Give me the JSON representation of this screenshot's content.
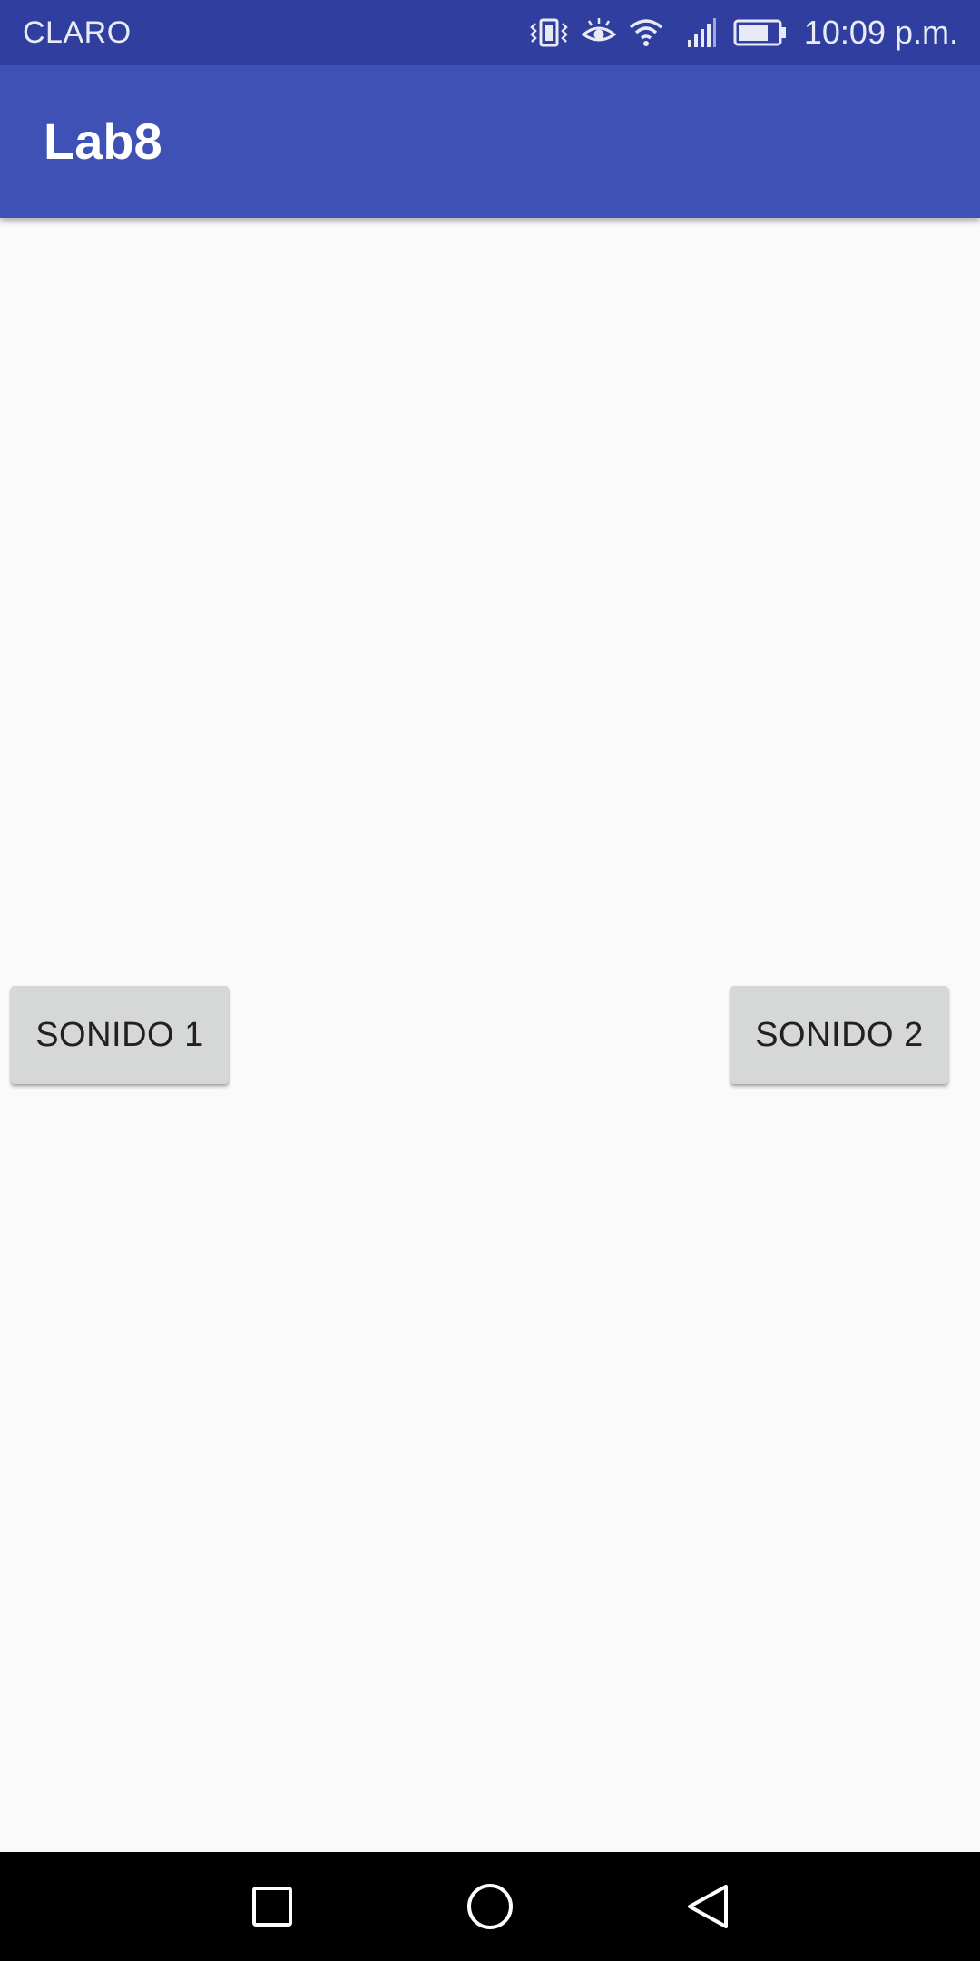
{
  "status_bar": {
    "carrier": "CLARO",
    "time": "10:09 p.m.",
    "icons": [
      "vibrate-icon",
      "eye-comfort-icon",
      "wifi-icon",
      "signal-icon",
      "battery-icon"
    ],
    "background": "#303F9F"
  },
  "app_bar": {
    "title": "Lab8",
    "background": "#3F51B5"
  },
  "main": {
    "buttons": [
      {
        "label": "SONIDO 1"
      },
      {
        "label": "SONIDO 2"
      }
    ]
  },
  "nav_bar": {
    "icons": [
      "recents-icon",
      "home-icon",
      "back-icon"
    ]
  }
}
